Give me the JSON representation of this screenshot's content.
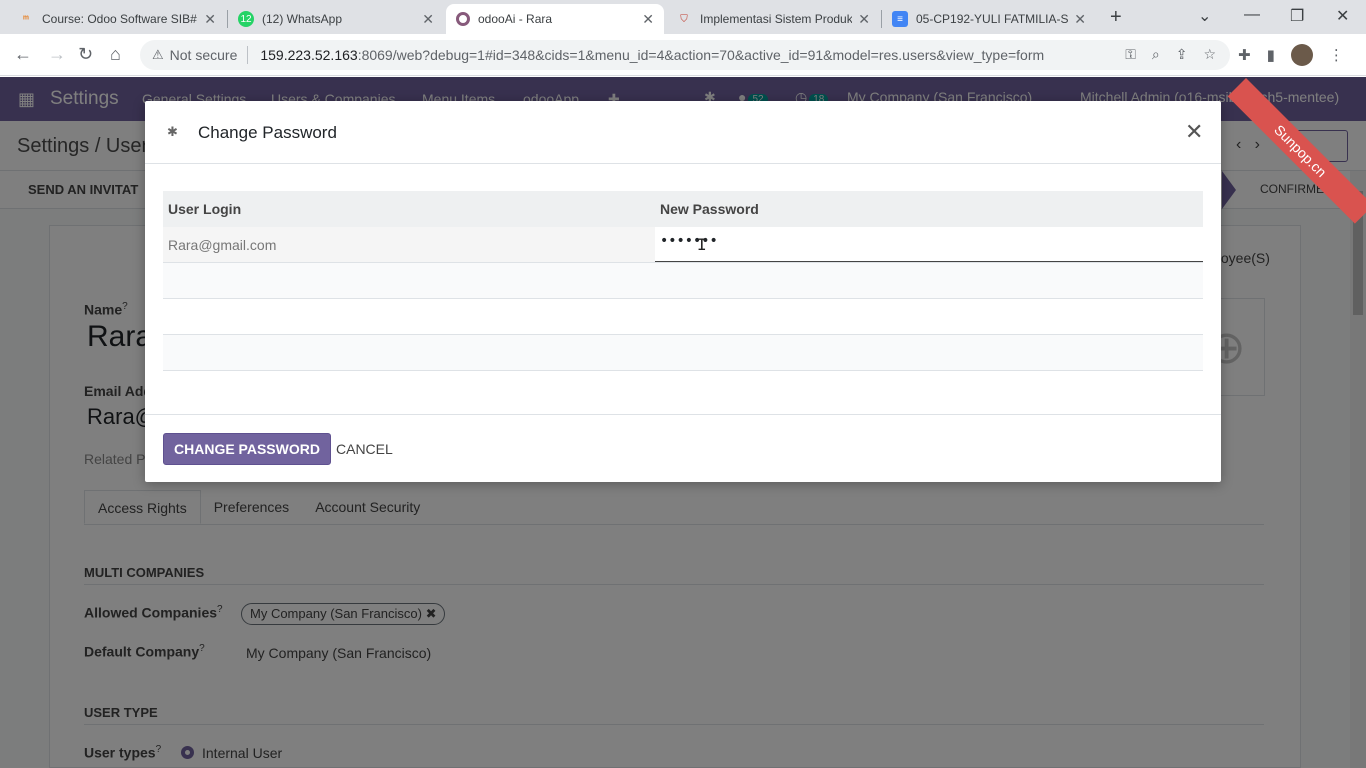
{
  "browser": {
    "tabs": [
      {
        "title": "Course: Odoo Software SIB#",
        "favicon": "odoo-course-icon",
        "active": false
      },
      {
        "title": "(12) WhatsApp",
        "favicon": "whatsapp-icon",
        "active": false
      },
      {
        "title": "odooAi - Rara",
        "favicon": "odoo-circle-icon",
        "active": true
      },
      {
        "title": "Implementasi Sistem Produk",
        "favicon": "shield-icon",
        "active": false
      },
      {
        "title": "05-CP192-YULI FATMILIA-SE",
        "favicon": "docs-icon",
        "active": false
      }
    ],
    "not_secure": "Not secure",
    "url_host": "159.223.52.163",
    "url_rest": ":8069/web?debug=1#id=348&cids=1&menu_id=4&action=70&active_id=91&model=res.users&view_type=form"
  },
  "odoo": {
    "app_name": "Settings",
    "menus": [
      "General Settings",
      "Users & Companies",
      "Menu Items",
      "odooApp"
    ],
    "messages_count": "52",
    "activities_count": "18",
    "company": "My Company (San Francisco)",
    "user": "Mitchell Admin (o16-msib-batch5-mentee)",
    "breadcrumb": "Settings / User",
    "send_invitation": "SEND AN INVITAT",
    "status_confirmed": "CONFIRMED",
    "employees": "ployee(S)",
    "name_label": "Name",
    "name_value": "Rara",
    "email_label": "Email Add",
    "email_value": "Rara@",
    "related": "Related Pa",
    "tabs": [
      "Access Rights",
      "Preferences",
      "Account Security"
    ],
    "multi_companies": "MULTI COMPANIES",
    "allowed_companies_label": "Allowed Companies",
    "allowed_company_tag": "My Company (San Francisco)",
    "default_company_label": "Default Company",
    "default_company_value": "My Company (San Francisco)",
    "user_type_title": "USER TYPE",
    "user_types_label": "User types",
    "user_type_value": "Internal User",
    "ribbon": "Sunpop.cn"
  },
  "dialog": {
    "title": "Change Password",
    "columns": [
      "User Login",
      "New Password"
    ],
    "rows": [
      {
        "login": "Rara@gmail.com",
        "password": "•••••••"
      }
    ],
    "primary_button": "CHANGE PASSWORD",
    "cancel_button": "CANCEL"
  },
  "colors": {
    "brand": "#71639e",
    "ribbon": "#d9534f"
  }
}
